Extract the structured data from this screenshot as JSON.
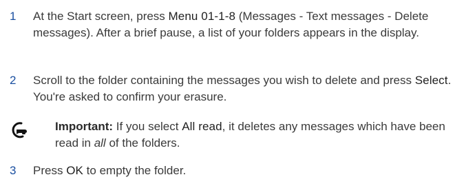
{
  "steps": [
    {
      "number": "1",
      "t1": "At the Start screen, press ",
      "k1": "Menu 01-1-8",
      "t2": " (Messages - Text messages - Delete messages). After a brief pause, a list of your folders appears in the display."
    },
    {
      "number": "2",
      "t1": "Scroll to the folder containing the messages you wish to delete and press ",
      "k1": "Select",
      "t2": ". You're asked to confirm your erasure."
    },
    {
      "number": "3",
      "t1": "Press ",
      "k1": "OK",
      "t2": " to empty the folder."
    }
  ],
  "note": {
    "icon": "pointing-hand-icon",
    "label": "Important:",
    "t1": " If you select ",
    "k1": "All read",
    "t2": ", it deletes any messages which have been read in ",
    "em": "all",
    "t3": " of the folders."
  },
  "colors": {
    "step_number": "#1a4fa0",
    "body_text": "#3a3a3a"
  }
}
